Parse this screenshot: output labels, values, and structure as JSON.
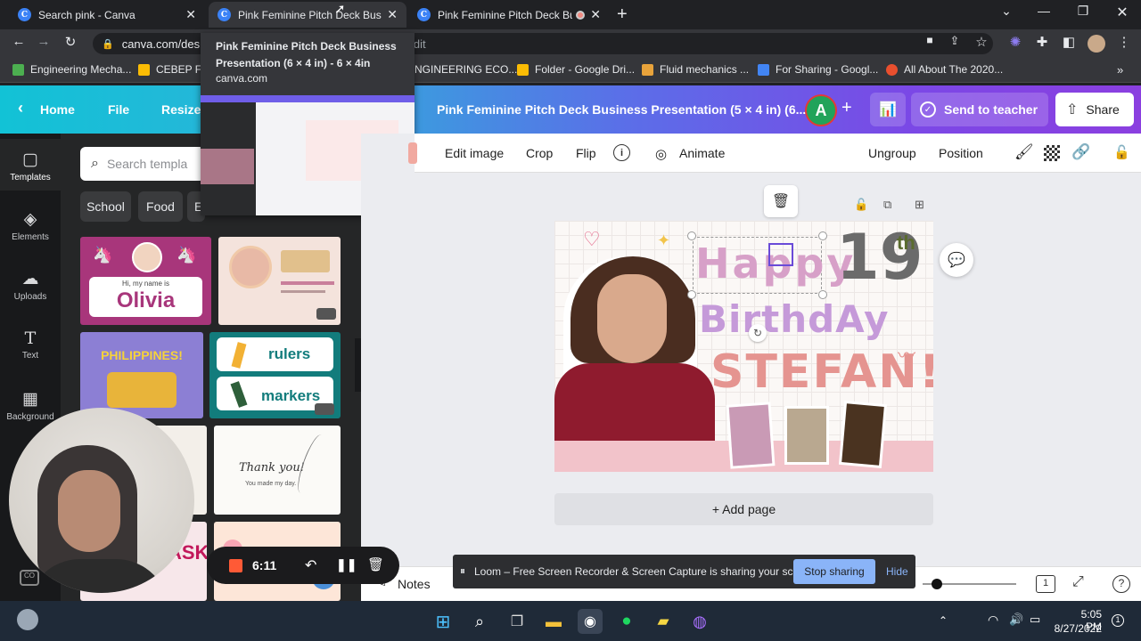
{
  "tabs": [
    {
      "title": "Search pink - Canva",
      "close": "✕"
    },
    {
      "title": "Pink Feminine Pitch Deck Busines",
      "close": "✕"
    },
    {
      "title": "Pink Feminine Pitch Deck Bu",
      "close": "✕"
    }
  ],
  "new_tab": "+",
  "omnibox": {
    "text_left": "canva.com/desi",
    "text_right": "/edit"
  },
  "tooltip": {
    "title": "Pink Feminine Pitch Deck Business Presentation (6 × 4 in) - 6 × 4in",
    "domain": "canva.com"
  },
  "bookmarks": [
    "Engineering Mecha...",
    "CEBEP File",
    "NGINEERING ECO...",
    "Folder - Google Dri...",
    "Fluid mechanics ...",
    "For Sharing - Googl...",
    "All About The 2020..."
  ],
  "canva_header": {
    "home": "Home",
    "file": "File",
    "resize": "Resize",
    "doc_title": "Pink Feminine Pitch Deck Business Presentation (5 × 4 in) (6...",
    "avatar_letter": "A",
    "send_to_teacher": "Send to teacher",
    "share": "Share"
  },
  "rail": [
    {
      "label": "Templates",
      "icon": "▢"
    },
    {
      "label": "Elements",
      "icon": "◈"
    },
    {
      "label": "Uploads",
      "icon": "☁"
    },
    {
      "label": "Text",
      "icon": "T"
    },
    {
      "label": "Background",
      "icon": "▦"
    }
  ],
  "search": {
    "placeholder": "Search templa"
  },
  "chips": [
    "School",
    "Food",
    "E"
  ],
  "templates": {
    "olivia": {
      "line1": "Hi, my name is",
      "name": "Olivia"
    },
    "philippines": "PHILIPPINES!",
    "rulers": "rulers",
    "markers": "markers",
    "thankyou": {
      "line1": "Thank you!",
      "line2": "You made my day."
    },
    "ask": "ASK"
  },
  "context_toolbar": {
    "edit_image": "Edit image",
    "crop": "Crop",
    "flip": "Flip",
    "animate": "Animate",
    "ungroup": "Ungroup",
    "position": "Position"
  },
  "design": {
    "happy": "Happy",
    "nineteen": "19",
    "th": "th",
    "birthday": "BirthdAy",
    "name": "STEFAN!"
  },
  "add_page": "+ Add page",
  "notes": "Notes",
  "recorder": {
    "time": "6:11"
  },
  "loom": {
    "message": "Loom – Free Screen Recorder & Screen Capture is sharing your screen.",
    "stop": "Stop sharing",
    "hide": "Hide"
  },
  "clock": {
    "time": "5:05 PM",
    "date": "8/27/2022"
  },
  "page_indicator": "1",
  "colors": {
    "canva_cyan": "#12c2d6",
    "canva_purple": "#8b3fe0",
    "loom_button": "#8ab4f8",
    "record_red": "#ff5a36"
  }
}
